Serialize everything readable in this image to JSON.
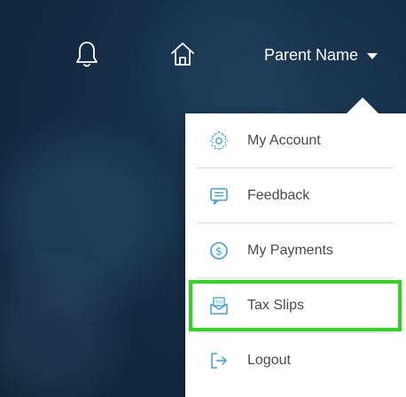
{
  "header": {
    "bell_icon": "bell-icon",
    "home_icon": "home-icon",
    "user_name": "Parent Name",
    "caret_icon": "caret-down-icon"
  },
  "dropdown": {
    "items": [
      {
        "label": "My Account",
        "icon": "gear-icon"
      },
      {
        "label": "Feedback",
        "icon": "message-icon"
      },
      {
        "label": "My Payments",
        "icon": "dollar-icon"
      },
      {
        "label": "Tax Slips",
        "icon": "tax-envelope-icon"
      },
      {
        "label": "Logout",
        "icon": "logout-icon"
      }
    ],
    "highlighted_item": "Tax Slips"
  },
  "colors": {
    "icon_accent": "#3aa0d8",
    "highlight_border": "#2bd81e",
    "header_text": "#ffffff",
    "menu_text": "#4a4a4a"
  }
}
